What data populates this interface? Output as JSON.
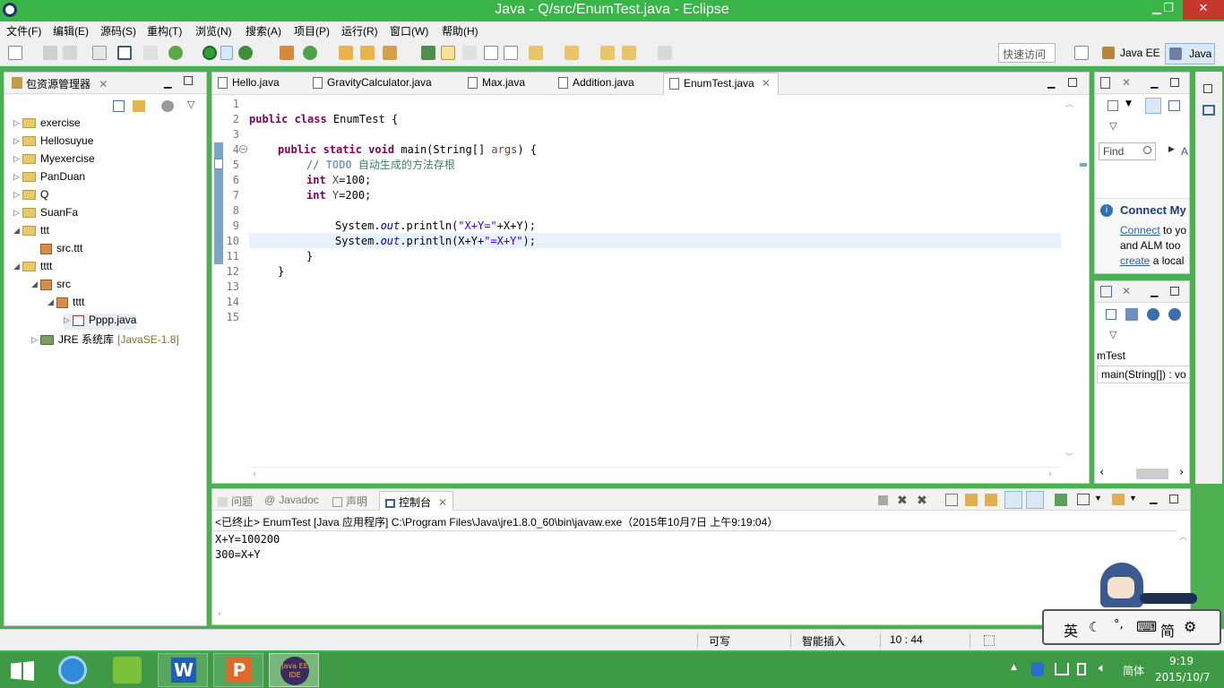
{
  "window": {
    "title": "Java - Q/src/EnumTest.java - Eclipse",
    "minimize": "▁",
    "restore": "❐",
    "close": "✕"
  },
  "menu": [
    "文件(F)",
    "编辑(E)",
    "源码(S)",
    "重构(T)",
    "浏览(N)",
    "搜索(A)",
    "项目(P)",
    "运行(R)",
    "窗口(W)",
    "帮助(H)"
  ],
  "toolbar": {
    "quick_access": "快速访问",
    "perspectives": [
      "Java EE",
      "Java"
    ]
  },
  "package_explorer": {
    "title": "包资源管理器",
    "items": [
      {
        "label": "exercise",
        "arrow": "▷",
        "indent": 0
      },
      {
        "label": "Hellosuyue",
        "arrow": "▷",
        "indent": 0
      },
      {
        "label": "Myexercise",
        "arrow": "▷",
        "indent": 0
      },
      {
        "label": "PanDuan",
        "arrow": "▷",
        "indent": 0
      },
      {
        "label": "Q",
        "arrow": "▷",
        "indent": 0
      },
      {
        "label": "SuanFa",
        "arrow": "▷",
        "indent": 0
      },
      {
        "label": "ttt",
        "arrow": "◢",
        "indent": 0
      },
      {
        "label": "src.ttt",
        "arrow": "",
        "indent": 1
      },
      {
        "label": "tttt",
        "arrow": "◢",
        "indent": 0
      },
      {
        "label": "src",
        "arrow": "◢",
        "indent": 1
      },
      {
        "label": "tttt",
        "arrow": "◢",
        "indent": 2
      },
      {
        "label": "Pppp.java",
        "arrow": "▷",
        "indent": 3
      },
      {
        "label": "JRE 系统库",
        "suffix": "[JavaSE-1.8]",
        "arrow": "▷",
        "indent": 1
      }
    ]
  },
  "editor": {
    "tabs": [
      "Hello.java",
      "GravityCalculator.java",
      "Max.java",
      "Addition.java",
      "EnumTest.java"
    ],
    "active_tab": "EnumTest.java",
    "line_numbers": [
      "1",
      "2",
      "3",
      "4",
      "5",
      "6",
      "7",
      "8",
      "9",
      "10",
      "11",
      "12",
      "13",
      "14",
      "15"
    ],
    "code": {
      "l2_kw": "public class",
      "l2_rest": " EnumTest {",
      "l4_kw": "public static void",
      "l4_rest": " main(String[] ",
      "l4_var": "args",
      "l4_end": ") {",
      "l5_cm": "// ",
      "l5_todo": "TODO",
      "l5_text": " 自动生成的方法存根",
      "l6_kw": "int",
      "l6_var": " X",
      "l6_rest": "=100;",
      "l7_kw": "int",
      "l7_var": " Y",
      "l7_rest": "=200;",
      "l9_a": "System.",
      "l9_fld": "out",
      "l9_b": ".println(",
      "l9_str": "\"X+Y=\"",
      "l9_c": "+X+Y);",
      "l10_a": "System.",
      "l10_fld": "out",
      "l10_b": ".println(X+Y+",
      "l10_str": "\"=X+Y\"",
      "l10_c": ");",
      "l11": "}",
      "l12": "}"
    }
  },
  "right_panels": {
    "find_placeholder": "Find",
    "find_extra": "A",
    "connect_title": "Connect My",
    "connect_line1_link": "Connect",
    "connect_line1_rest": " to yo",
    "connect_line2": "and ALM too",
    "connect_line3_link": "create",
    "connect_line3_rest": " a local",
    "outline_class": "mTest",
    "outline_method": "main(String[]) : vo"
  },
  "console": {
    "tabs": [
      "问题",
      "Javadoc",
      "声明",
      "控制台"
    ],
    "active_tab": "控制台",
    "header": "<已终止> EnumTest [Java 应用程序] C:\\Program Files\\Java\\jre1.8.0_60\\bin\\javaw.exe（2015年10月7日 上午9:19:04）",
    "output": [
      "X+Y=100200",
      "300=X+Y"
    ]
  },
  "status": {
    "writable": "可写",
    "insert_mode": "智能插入",
    "position": "10 : 44"
  },
  "ime": {
    "items": [
      "英",
      "☾",
      "°,",
      "⌨",
      "简",
      "⚙"
    ]
  },
  "taskbar": {
    "lang": "简体",
    "time": "9:19",
    "date": "2015/10/7",
    "eclipse_label": "Java EE IDE"
  }
}
